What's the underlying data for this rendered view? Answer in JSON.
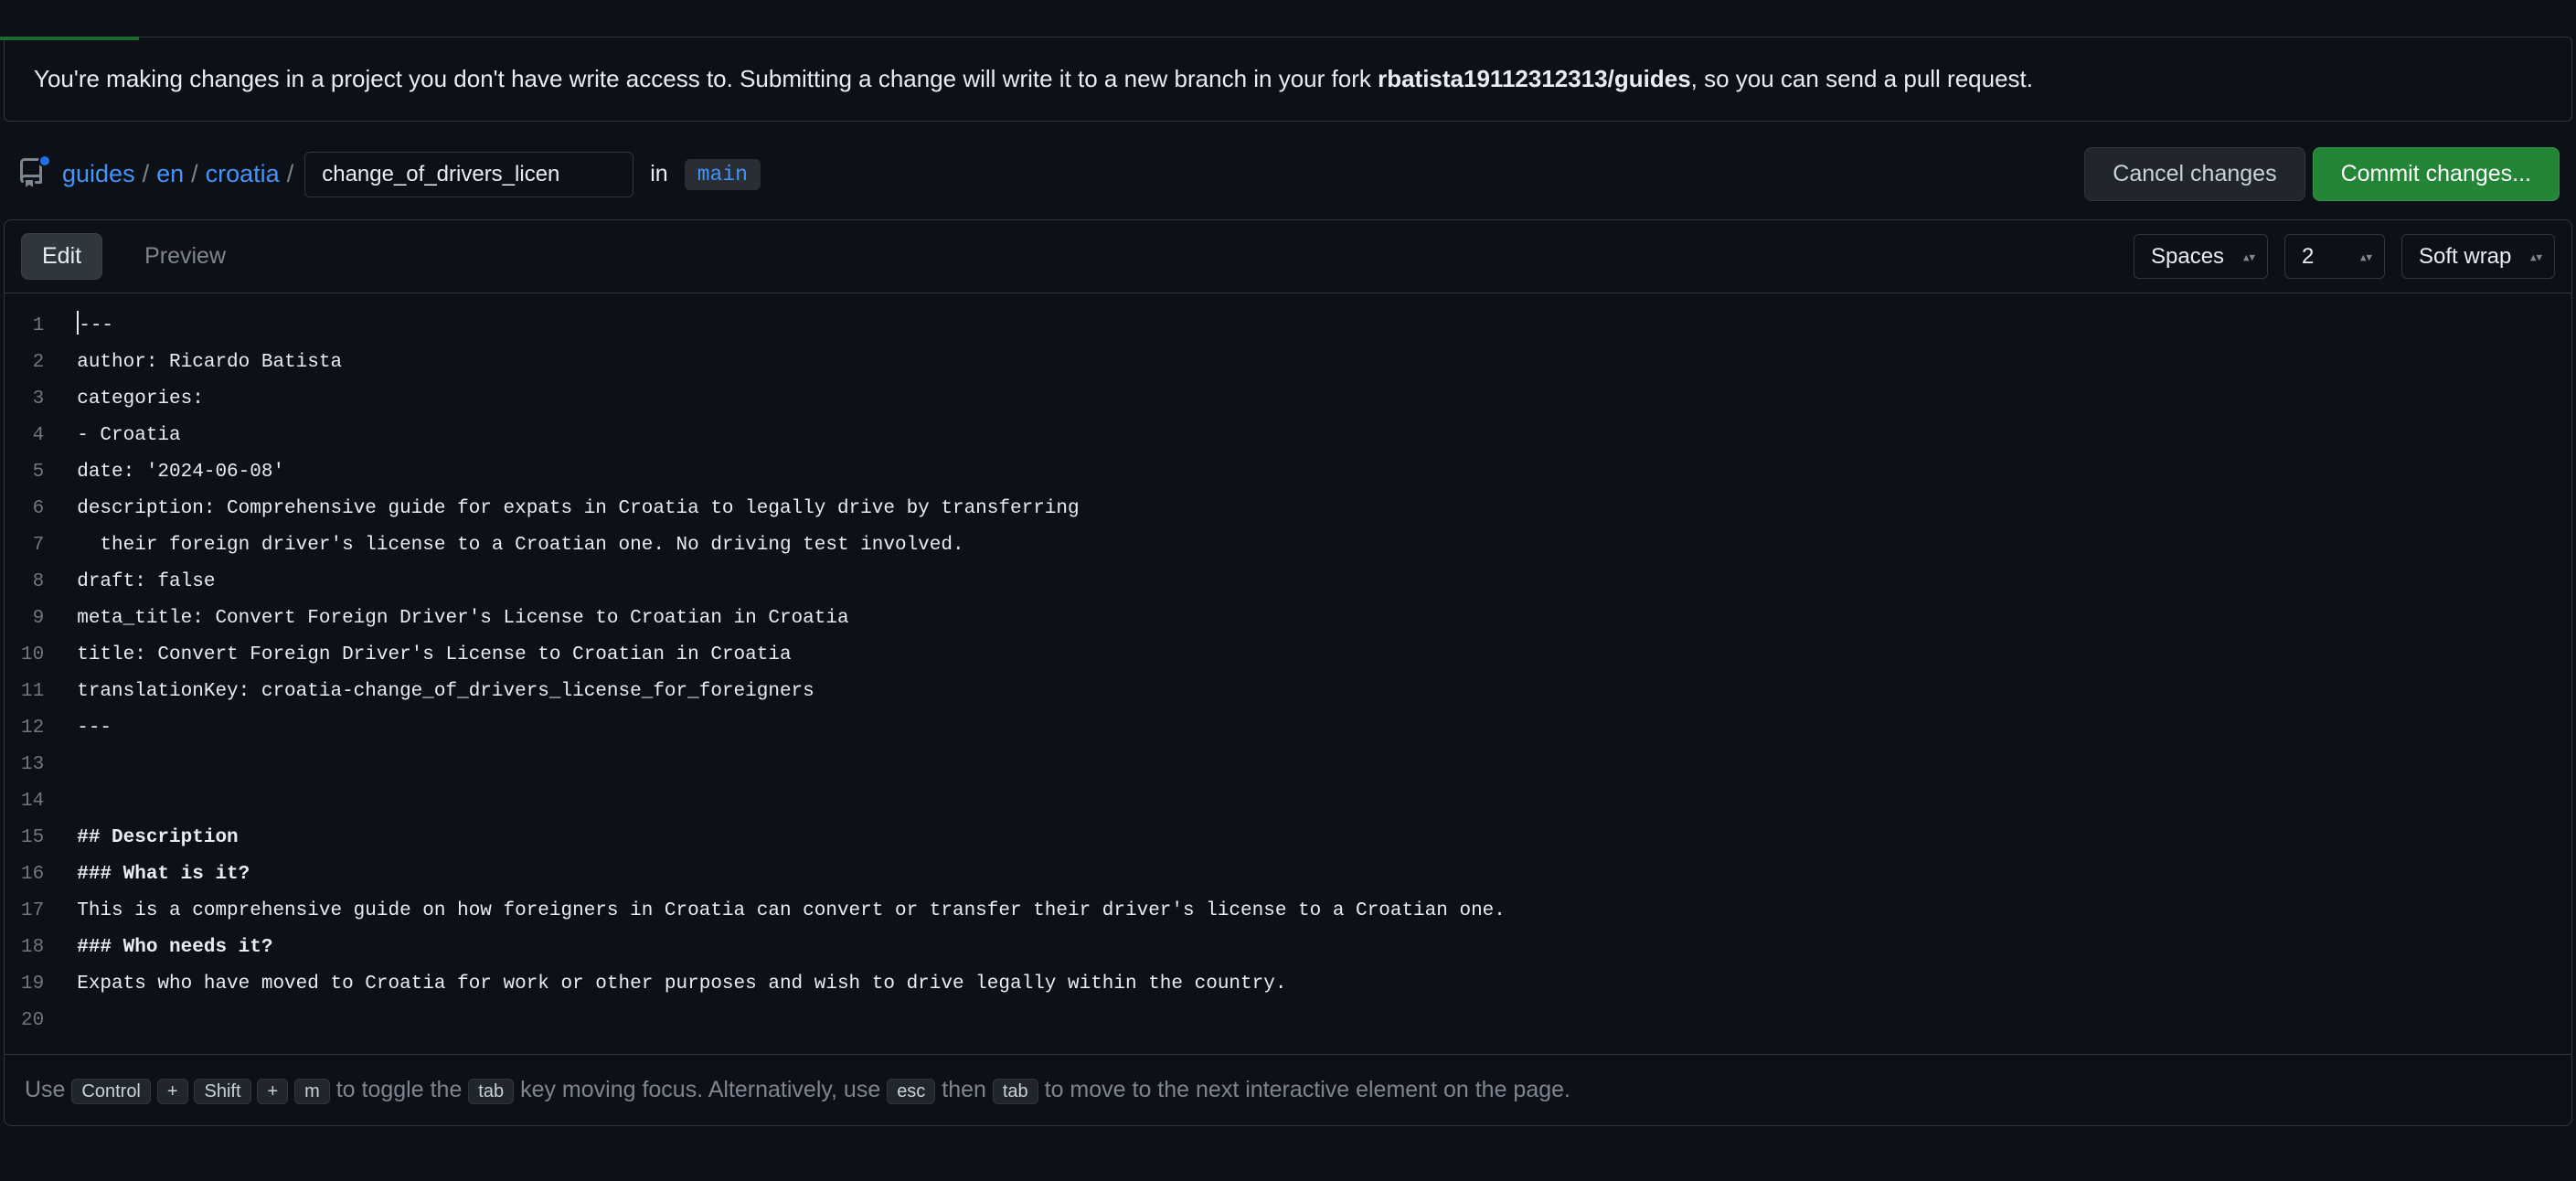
{
  "notice": {
    "prefix": "You're making changes in a project you don't have write access to. Submitting a change will write it to a new branch in your fork ",
    "fork": "rbatista19112312313/guides",
    "suffix": ", so you can send a pull request."
  },
  "breadcrumb": {
    "parts": [
      "guides",
      "en",
      "croatia"
    ],
    "sep": "/",
    "filename": "change_of_drivers_licen",
    "in_label": "in",
    "branch": "main"
  },
  "actions": {
    "cancel": "Cancel changes",
    "commit": "Commit changes..."
  },
  "tabs": {
    "edit": "Edit",
    "preview": "Preview"
  },
  "settings": {
    "indent_mode": "Spaces",
    "indent_size": "2",
    "wrap_mode": "Soft wrap"
  },
  "code": {
    "lines": [
      "---",
      "author: Ricardo Batista",
      "categories:",
      "- Croatia",
      "date: '2024-06-08'",
      "description: Comprehensive guide for expats in Croatia to legally drive by transferring",
      "  their foreign driver's license to a Croatian one. No driving test involved.",
      "draft: false",
      "meta_title: Convert Foreign Driver's License to Croatian in Croatia",
      "title: Convert Foreign Driver's License to Croatian in Croatia",
      "translationKey: croatia-change_of_drivers_license_for_foreigners",
      "---",
      "",
      "",
      "## Description",
      "### What is it?",
      "This is a comprehensive guide on how foreigners in Croatia can convert or transfer their driver's license to a Croatian one.",
      "### Who needs it?",
      "Expats who have moved to Croatia for work or other purposes and wish to drive legally within the country.",
      ""
    ]
  },
  "hint": {
    "p1": "Use ",
    "kbd1": "Control",
    "plus": "+",
    "kbd2": "Shift",
    "kbd3": "m",
    "p2": " to toggle the ",
    "kbd4": "tab",
    "p3": " key moving focus. Alternatively, use ",
    "kbd5": "esc",
    "p4": " then ",
    "kbd6": "tab",
    "p5": " to move to the next interactive element on the page."
  }
}
